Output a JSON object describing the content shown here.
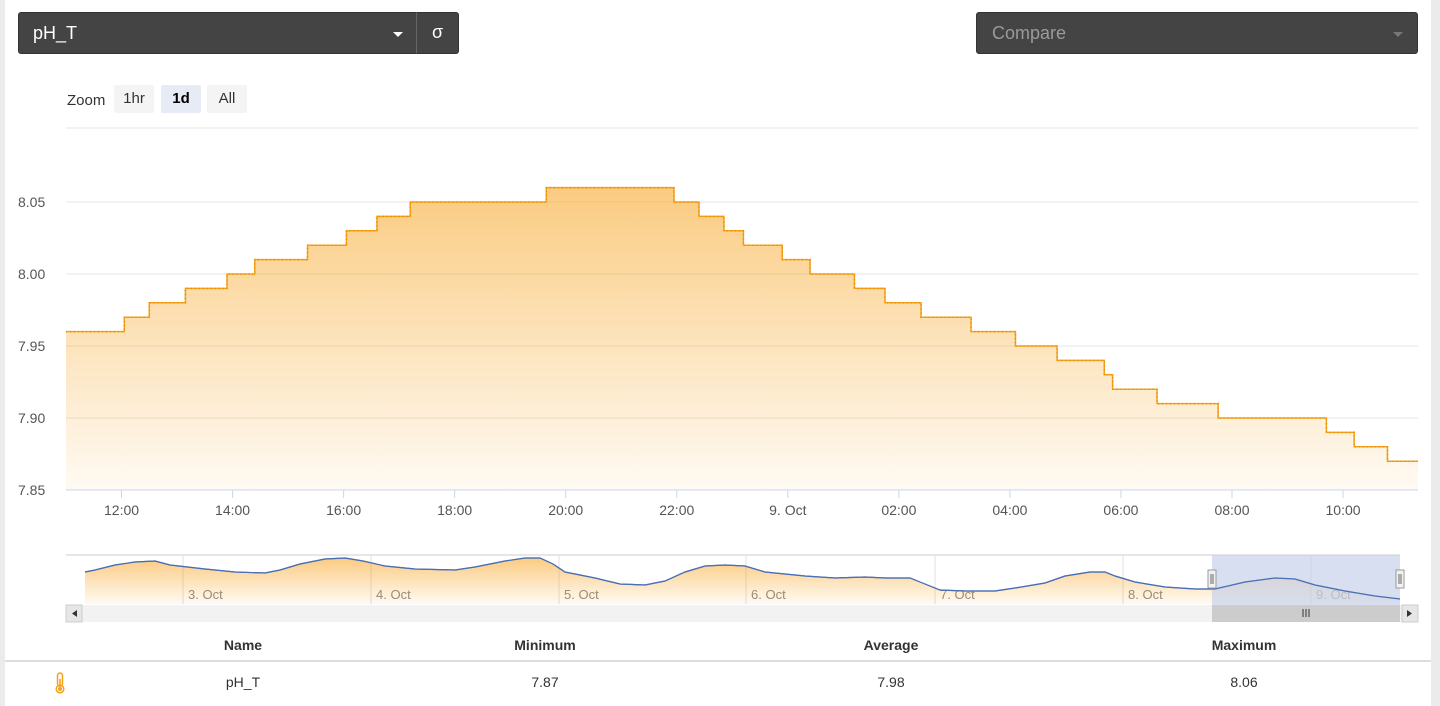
{
  "sensor_select": {
    "value": "pH_T"
  },
  "sigma_button": {
    "label": "σ"
  },
  "compare_select": {
    "placeholder": "Compare"
  },
  "zoom": {
    "label": "Zoom",
    "buttons": [
      "1hr",
      "1d",
      "All"
    ],
    "active": "1d"
  },
  "colors": {
    "series": "#f7a11a",
    "navigator_line": "#4a6fb5",
    "selector_bg": "#c8d2ea",
    "dark_ui": "#444444"
  },
  "chart_data": {
    "type": "area",
    "series_name": "pH_T",
    "y_ticks": [
      "8.05",
      "8.00",
      "7.95",
      "7.90",
      "7.85"
    ],
    "ylim": [
      7.85,
      8.1
    ],
    "x_ticks": [
      "12:00",
      "14:00",
      "16:00",
      "18:00",
      "20:00",
      "22:00",
      "9. Oct",
      "02:00",
      "04:00",
      "06:00",
      "08:00",
      "10:00"
    ],
    "x_hours": [
      11.0,
      12.0,
      14.0,
      16.0,
      18.0,
      20.0,
      22.0,
      24.0,
      26.0,
      28.0,
      30.0,
      32.0,
      34.0,
      35.35
    ],
    "steps": [
      [
        11.0,
        7.96
      ],
      [
        12.05,
        7.97
      ],
      [
        12.5,
        7.98
      ],
      [
        13.15,
        7.99
      ],
      [
        13.9,
        8.0
      ],
      [
        14.4,
        8.01
      ],
      [
        15.35,
        8.02
      ],
      [
        16.05,
        8.03
      ],
      [
        16.6,
        8.04
      ],
      [
        17.2,
        8.05
      ],
      [
        19.65,
        8.06
      ],
      [
        21.95,
        8.05
      ],
      [
        22.4,
        8.04
      ],
      [
        22.85,
        8.03
      ],
      [
        23.2,
        8.02
      ],
      [
        23.9,
        8.01
      ],
      [
        24.4,
        8.0
      ],
      [
        25.2,
        7.99
      ],
      [
        25.75,
        7.98
      ],
      [
        26.4,
        7.97
      ],
      [
        27.3,
        7.96
      ],
      [
        28.1,
        7.95
      ],
      [
        28.85,
        7.94
      ],
      [
        29.7,
        7.93
      ],
      [
        29.85,
        7.92
      ],
      [
        30.65,
        7.91
      ],
      [
        31.75,
        7.9
      ],
      [
        33.7,
        7.89
      ],
      [
        34.2,
        7.88
      ],
      [
        34.8,
        7.87
      ]
    ],
    "navigator": {
      "date_labels": [
        "3. Oct",
        "4. Oct",
        "5. Oct",
        "6. Oct",
        "7. Oct",
        "8. Oct",
        "9. Oct"
      ]
    }
  },
  "stats": {
    "headers": {
      "name": "Name",
      "min": "Minimum",
      "avg": "Average",
      "max": "Maximum"
    },
    "rows": [
      {
        "icon": "thermometer-icon",
        "name": "pH_T",
        "min": "7.87",
        "avg": "7.98",
        "max": "8.06"
      }
    ]
  }
}
